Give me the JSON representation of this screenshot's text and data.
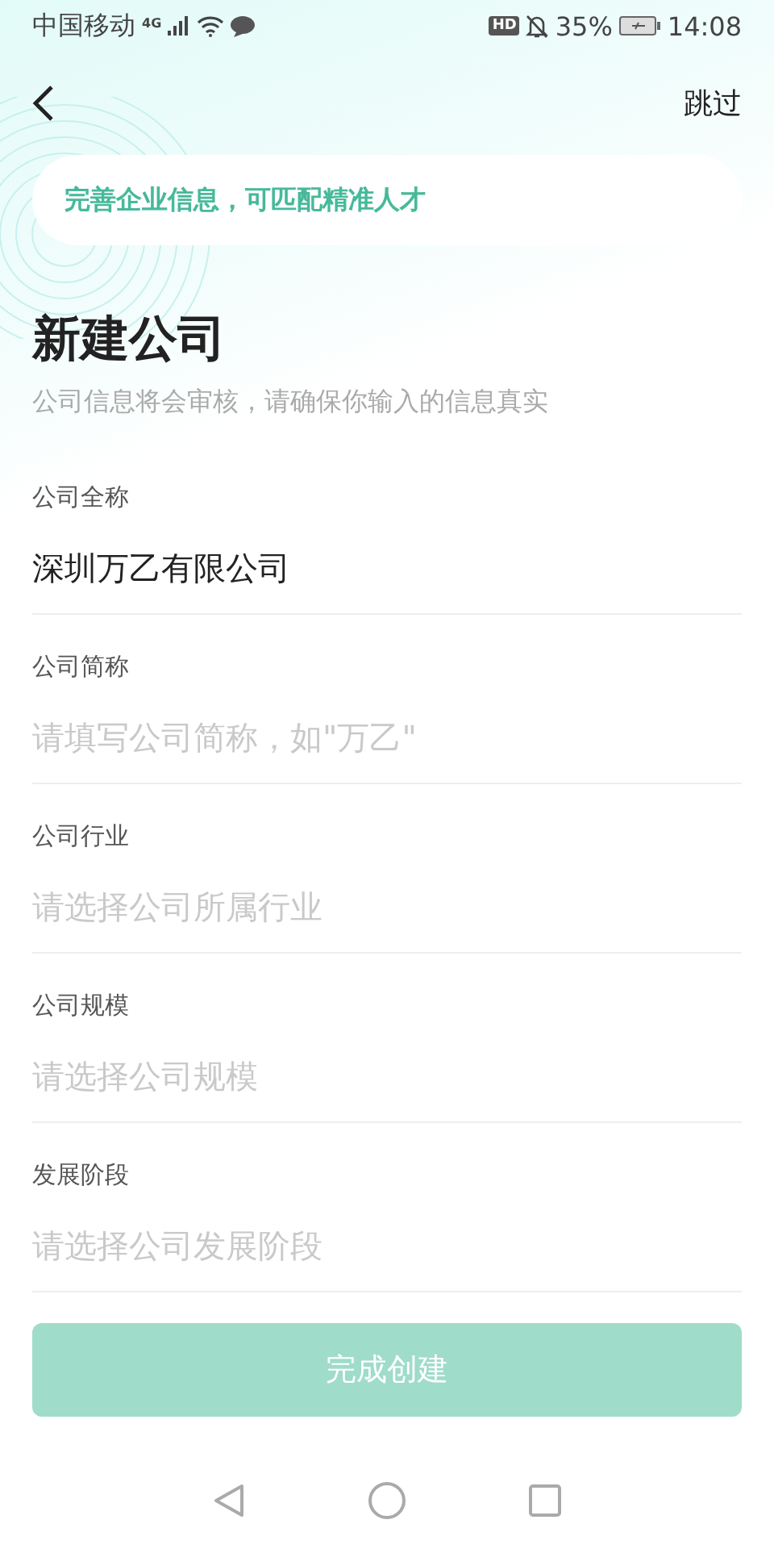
{
  "status_bar": {
    "carrier": "中国移动",
    "network": "4G",
    "hd": "HD",
    "battery": "35%",
    "time": "14:08"
  },
  "nav": {
    "skip": "跳过"
  },
  "banner": {
    "text": "完善企业信息，可匹配精准人才"
  },
  "title": "新建公司",
  "subtitle": "公司信息将会审核，请确保你输入的信息真实",
  "fields": [
    {
      "label": "公司全称",
      "value": "深圳万乙有限公司"
    },
    {
      "label": "公司简称",
      "placeholder": "请填写公司简称，如\"万乙\""
    },
    {
      "label": "公司行业",
      "placeholder": "请选择公司所属行业"
    },
    {
      "label": "公司规模",
      "placeholder": "请选择公司规模"
    },
    {
      "label": "发展阶段",
      "placeholder": "请选择公司发展阶段"
    }
  ],
  "submit": {
    "label": "完成创建",
    "disabled": true
  }
}
